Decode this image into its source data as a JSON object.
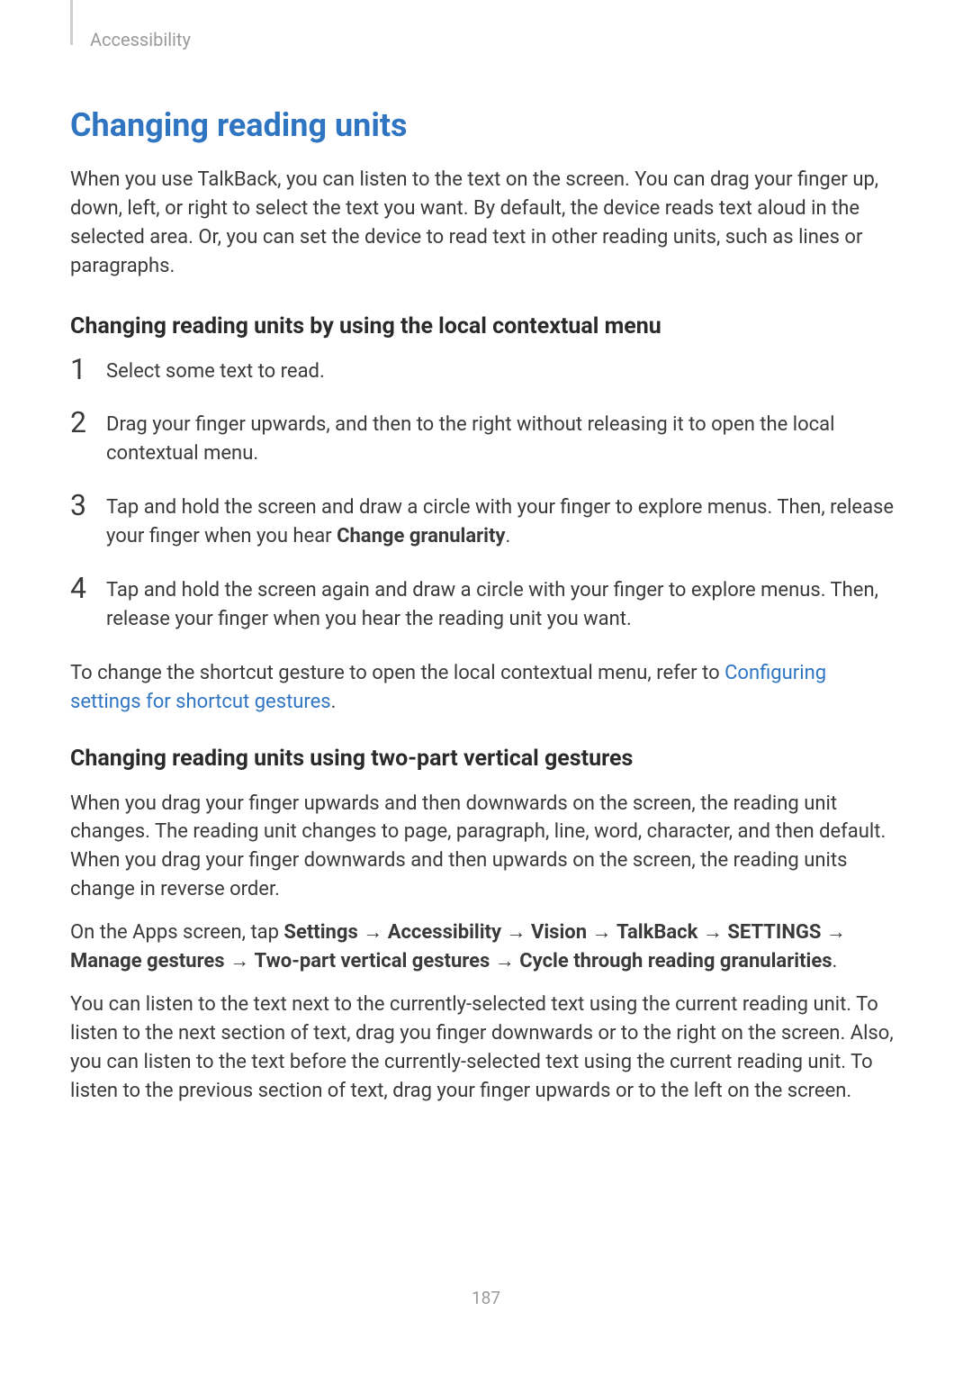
{
  "breadcrumb": "Accessibility",
  "title": "Changing reading units",
  "intro": "When you use TalkBack, you can listen to the text on the screen. You can drag your finger up, down, left, or right to select the text you want. By default, the device reads text aloud in the selected area. Or, you can set the device to read text in other reading units, such as lines or paragraphs.",
  "section1": {
    "heading": "Changing reading units by using the local contextual menu",
    "steps": [
      {
        "num": "1",
        "text_before": "Select some text to read.",
        "bold": "",
        "text_after": ""
      },
      {
        "num": "2",
        "text_before": "Drag your finger upwards, and then to the right without releasing it to open the local contextual menu.",
        "bold": "",
        "text_after": ""
      },
      {
        "num": "3",
        "text_before": "Tap and hold the screen and draw a circle with your finger to explore menus. Then, release your finger when you hear ",
        "bold": "Change granularity",
        "text_after": "."
      },
      {
        "num": "4",
        "text_before": "Tap and hold the screen again and draw a circle with your finger to explore menus. Then, release your finger when you hear the reading unit you want.",
        "bold": "",
        "text_after": ""
      }
    ],
    "footer_before": "To change the shortcut gesture to open the local contextual menu, refer to ",
    "footer_link": "Configuring settings for shortcut gestures",
    "footer_after": "."
  },
  "section2": {
    "heading": "Changing reading units using two-part vertical gestures",
    "para1": "When you drag your finger upwards and then downwards on the screen, the reading unit changes. The reading unit changes to page, paragraph, line, word, character, and then default. When you drag your finger downwards and then upwards on the screen, the reading units change in reverse order.",
    "nav": {
      "prefix": "On the Apps screen, tap ",
      "seg1": "Settings",
      "seg2": "Accessibility",
      "seg3": "Vision",
      "seg4": "TalkBack",
      "seg5": "SETTINGS",
      "seg6": "Manage gestures",
      "seg7": "Two-part vertical gestures",
      "seg8": "Cycle through reading granularities",
      "arrow": " → ",
      "suffix": "."
    },
    "para3": "You can listen to the text next to the currently-selected text using the current reading unit. To listen to the next section of text, drag you finger downwards or to the right on the screen. Also, you can listen to the text before the currently-selected text using the current reading unit. To listen to the previous section of text, drag your finger upwards or to the left on the screen."
  },
  "page_number": "187"
}
